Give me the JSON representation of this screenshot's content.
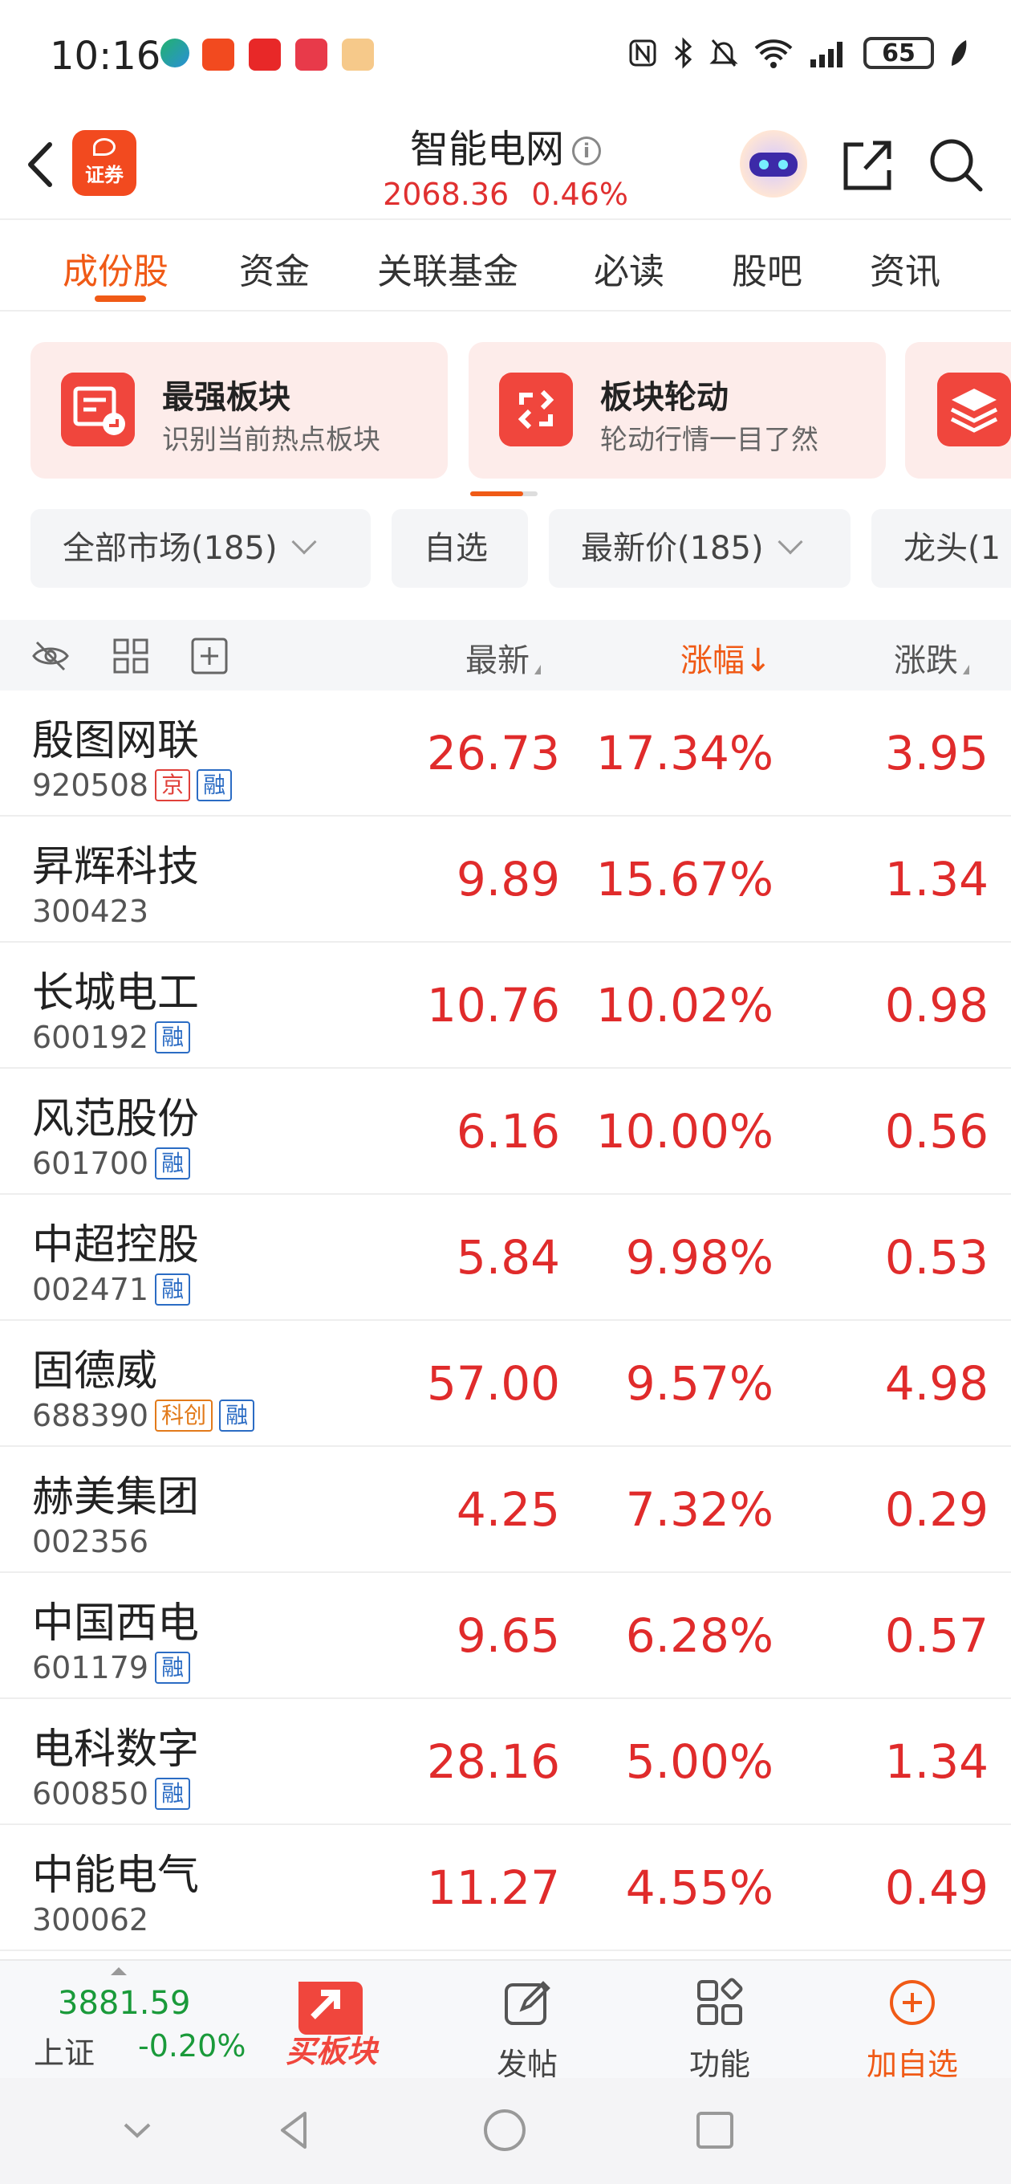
{
  "status_bar": {
    "time": "10:16",
    "battery": "65",
    "icons": [
      "nfc-icon",
      "bluetooth-icon",
      "mute-icon",
      "wifi-icon",
      "signal-icon",
      "battery-icon",
      "leaf-icon"
    ]
  },
  "header": {
    "logo_text": "证券",
    "title": "智能电网",
    "index_value": "2068.36",
    "index_change": "0.46%"
  },
  "tabs": [
    {
      "label": "成份股",
      "active": true
    },
    {
      "label": "资金",
      "active": false
    },
    {
      "label": "关联基金",
      "active": false
    },
    {
      "label": "必读",
      "active": false
    },
    {
      "label": "股吧",
      "active": false
    },
    {
      "label": "资讯",
      "active": false
    }
  ],
  "cards": [
    {
      "title": "最强板块",
      "subtitle": "识别当前热点板块",
      "icon": "chart-thumb-icon"
    },
    {
      "title": "板块轮动",
      "subtitle": "轮动行情一目了然",
      "icon": "rotate-icon"
    },
    {
      "title": "",
      "subtitle": "",
      "icon": "layers-icon"
    }
  ],
  "filters": [
    {
      "label": "全部市场(185)",
      "has_dropdown": true
    },
    {
      "label": "自选",
      "has_dropdown": false
    },
    {
      "label": "最新价(185)",
      "has_dropdown": true
    },
    {
      "label": "龙头(1",
      "has_dropdown": false
    }
  ],
  "table": {
    "columns": {
      "latest": "最新",
      "pct": "涨幅↓",
      "change": "涨跌"
    },
    "rows": [
      {
        "name": "殷图网联",
        "code": "920508",
        "tags": [
          "京",
          "融"
        ],
        "latest": "26.73",
        "pct": "17.34%",
        "change": "3.95"
      },
      {
        "name": "昇辉科技",
        "code": "300423",
        "tags": [],
        "latest": "9.89",
        "pct": "15.67%",
        "change": "1.34"
      },
      {
        "name": "长城电工",
        "code": "600192",
        "tags": [
          "融"
        ],
        "latest": "10.76",
        "pct": "10.02%",
        "change": "0.98"
      },
      {
        "name": "风范股份",
        "code": "601700",
        "tags": [
          "融"
        ],
        "latest": "6.16",
        "pct": "10.00%",
        "change": "0.56"
      },
      {
        "name": "中超控股",
        "code": "002471",
        "tags": [
          "融"
        ],
        "latest": "5.84",
        "pct": "9.98%",
        "change": "0.53"
      },
      {
        "name": "固德威",
        "code": "688390",
        "tags": [
          "科创",
          "融"
        ],
        "latest": "57.00",
        "pct": "9.57%",
        "change": "4.98"
      },
      {
        "name": "赫美集团",
        "code": "002356",
        "tags": [],
        "latest": "4.25",
        "pct": "7.32%",
        "change": "0.29"
      },
      {
        "name": "中国西电",
        "code": "601179",
        "tags": [
          "融"
        ],
        "latest": "9.65",
        "pct": "6.28%",
        "change": "0.57"
      },
      {
        "name": "电科数字",
        "code": "600850",
        "tags": [
          "融"
        ],
        "latest": "28.16",
        "pct": "5.00%",
        "change": "1.34"
      },
      {
        "name": "中能电气",
        "code": "300062",
        "tags": [],
        "latest": "11.27",
        "pct": "4.55%",
        "change": "0.49"
      }
    ]
  },
  "bottom_bar": {
    "index_value": "3881.59",
    "index_name": "上证",
    "index_change": "-0.20%",
    "buy_block_label": "买板块",
    "post_label": "发帖",
    "function_label": "功能",
    "add_watch_label": "加自选"
  },
  "colors": {
    "accent": "#f05a16",
    "up_red": "#e02b2b",
    "down_green": "#1a9a3a"
  }
}
